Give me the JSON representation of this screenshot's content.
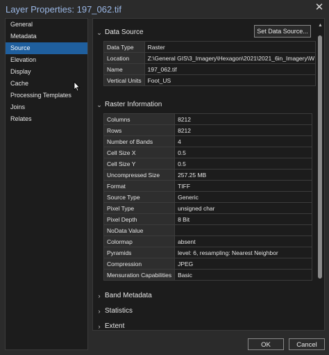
{
  "window": {
    "title": "Layer Properties: 197_062.tif"
  },
  "sidebar": {
    "items": [
      {
        "label": "General"
      },
      {
        "label": "Metadata"
      },
      {
        "label": "Source",
        "active": true
      },
      {
        "label": "Elevation"
      },
      {
        "label": "Display"
      },
      {
        "label": "Cache"
      },
      {
        "label": "Processing Templates"
      },
      {
        "label": "Joins"
      },
      {
        "label": "Relates"
      }
    ]
  },
  "data_source": {
    "header": "Data Source",
    "set_button": "Set Data Source...",
    "rows": [
      {
        "label": "Data Type",
        "value": "Raster"
      },
      {
        "label": "Location",
        "value": "Z:\\General GIS\\3_Imagery\\Hexagon\\2021\\2021_6in_Imagery\\W"
      },
      {
        "label": "Name",
        "value": "197_062.tif"
      },
      {
        "label": "Vertical Units",
        "value": "Foot_US"
      }
    ]
  },
  "raster_info": {
    "header": "Raster Information",
    "rows": [
      {
        "label": "Columns",
        "value": "8212"
      },
      {
        "label": "Rows",
        "value": "8212"
      },
      {
        "label": "Number of Bands",
        "value": "4"
      },
      {
        "label": "Cell Size X",
        "value": "0.5"
      },
      {
        "label": "Cell Size Y",
        "value": "0.5"
      },
      {
        "label": "Uncompressed Size",
        "value": "257.25 MB"
      },
      {
        "label": "Format",
        "value": "TIFF"
      },
      {
        "label": "Source Type",
        "value": "Generic"
      },
      {
        "label": "Pixel Type",
        "value": "unsigned char"
      },
      {
        "label": "Pixel Depth",
        "value": "8 Bit"
      },
      {
        "label": "NoData Value",
        "value": ""
      },
      {
        "label": "Colormap",
        "value": "absent"
      },
      {
        "label": "Pyramids",
        "value": "level: 6, resampling: Nearest Neighbor"
      },
      {
        "label": "Compression",
        "value": "JPEG"
      },
      {
        "label": "Mensuration Capabilities",
        "value": "Basic"
      }
    ]
  },
  "collapsed_sections": [
    {
      "label": "Band Metadata"
    },
    {
      "label": "Statistics"
    },
    {
      "label": "Extent"
    }
  ],
  "footer": {
    "ok": "OK",
    "cancel": "Cancel"
  },
  "icons": {
    "expanded": "chevron-down-icon",
    "collapsed": "chevron-right-icon",
    "close": "close-icon"
  },
  "colors": {
    "accent": "#1f5f9e",
    "background": "#2b2b2b",
    "panel": "#1c1c1c"
  }
}
